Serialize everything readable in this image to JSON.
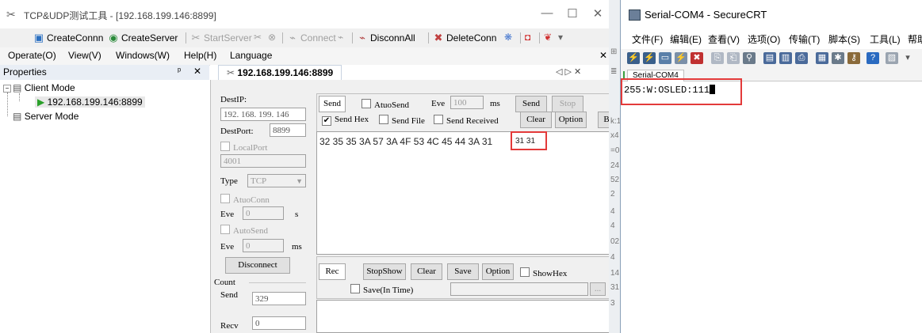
{
  "tcp_tool": {
    "title": "TCP&UDP测试工具 - [192.168.199.146:8899]",
    "window_controls": {
      "minimize": "—",
      "maximize": "☐",
      "close": "✕"
    },
    "toolbar": {
      "create_conn": "CreateConnn",
      "create_server": "CreateServer",
      "start_server": "StartServer",
      "connect": "Connect",
      "disconn_all": "DisconnAll",
      "delete_conn": "DeleteConn"
    },
    "menu": [
      "Operate(O)",
      "View(V)",
      "Windows(W)",
      "Help(H)",
      "Language"
    ],
    "menu_close": "✕",
    "properties": {
      "title": "Properties",
      "pin": "ᵖ",
      "close": "✕",
      "tree": {
        "client_mode": "Client Mode",
        "client_child": "192.168.199.146:8899",
        "server_mode": "Server Mode"
      }
    },
    "doc_tab": {
      "label": "192.168.199.146:8899",
      "nav": "◁ ▷ ✕"
    },
    "panel": {
      "dest_ip_label": "DestIP:",
      "dest_ip_value": "192. 168. 199. 146",
      "dest_port_label": "DestPort:",
      "dest_port_value": "8899",
      "local_port_label": "LocalPort",
      "local_port_value": "4001",
      "type_label": "Type",
      "type_value": "TCP",
      "auto_conn_label": "AtuoConn",
      "eve_label": "Eve",
      "eve_value": "0",
      "eve_unit": "s",
      "auto_send_label": "AutoSend",
      "eve2_label": "Eve",
      "eve2_value": "0",
      "eve2_unit": "ms",
      "disconnect": "Disconnect",
      "count_label": "Count",
      "send_label": "Send",
      "send_count": "329",
      "recv_label": "Recv",
      "recv_count": "0"
    },
    "send_bar": {
      "send_tag": "Send",
      "auto_send": "AtuoSend",
      "eve_label": "Eve",
      "eve_value": "100",
      "unit": "ms",
      "send_btn": "Send",
      "stop_btn": "Stop",
      "send_hex": "Send Hex",
      "send_file": "Send File",
      "send_received": "Send Received",
      "clear_btn": "Clear",
      "option_btn": "Option",
      "extra_btn": "B"
    },
    "send_data": "32 35 35 3A 57 3A 4F 53 4C 45 44 3A 31",
    "send_data_highlight": "31 31",
    "rec_bar": {
      "rec_tag": "Rec",
      "stop_show": "StopShow",
      "clear": "Clear",
      "save": "Save",
      "option": "Option",
      "show_hex": "ShowHex",
      "save_in_time": "Save(In Time)",
      "browse": "..."
    }
  },
  "strip": [
    "⊞",
    "≣",
    "k:1",
    "x4",
    "=0",
    "24",
    "52",
    "2",
    "4",
    "4",
    "02",
    "4",
    "14",
    "31",
    "3"
  ],
  "securecrt": {
    "title": "Serial-COM4 - SecureCRT",
    "menu": [
      "文件(F)",
      "编辑(E)",
      "查看(V)",
      "选项(O)",
      "传输(T)",
      "脚本(S)",
      "工具(L)",
      "帮助"
    ],
    "tab": "Serial-COM4",
    "terminal_text": "255:W:OSLED:111"
  }
}
